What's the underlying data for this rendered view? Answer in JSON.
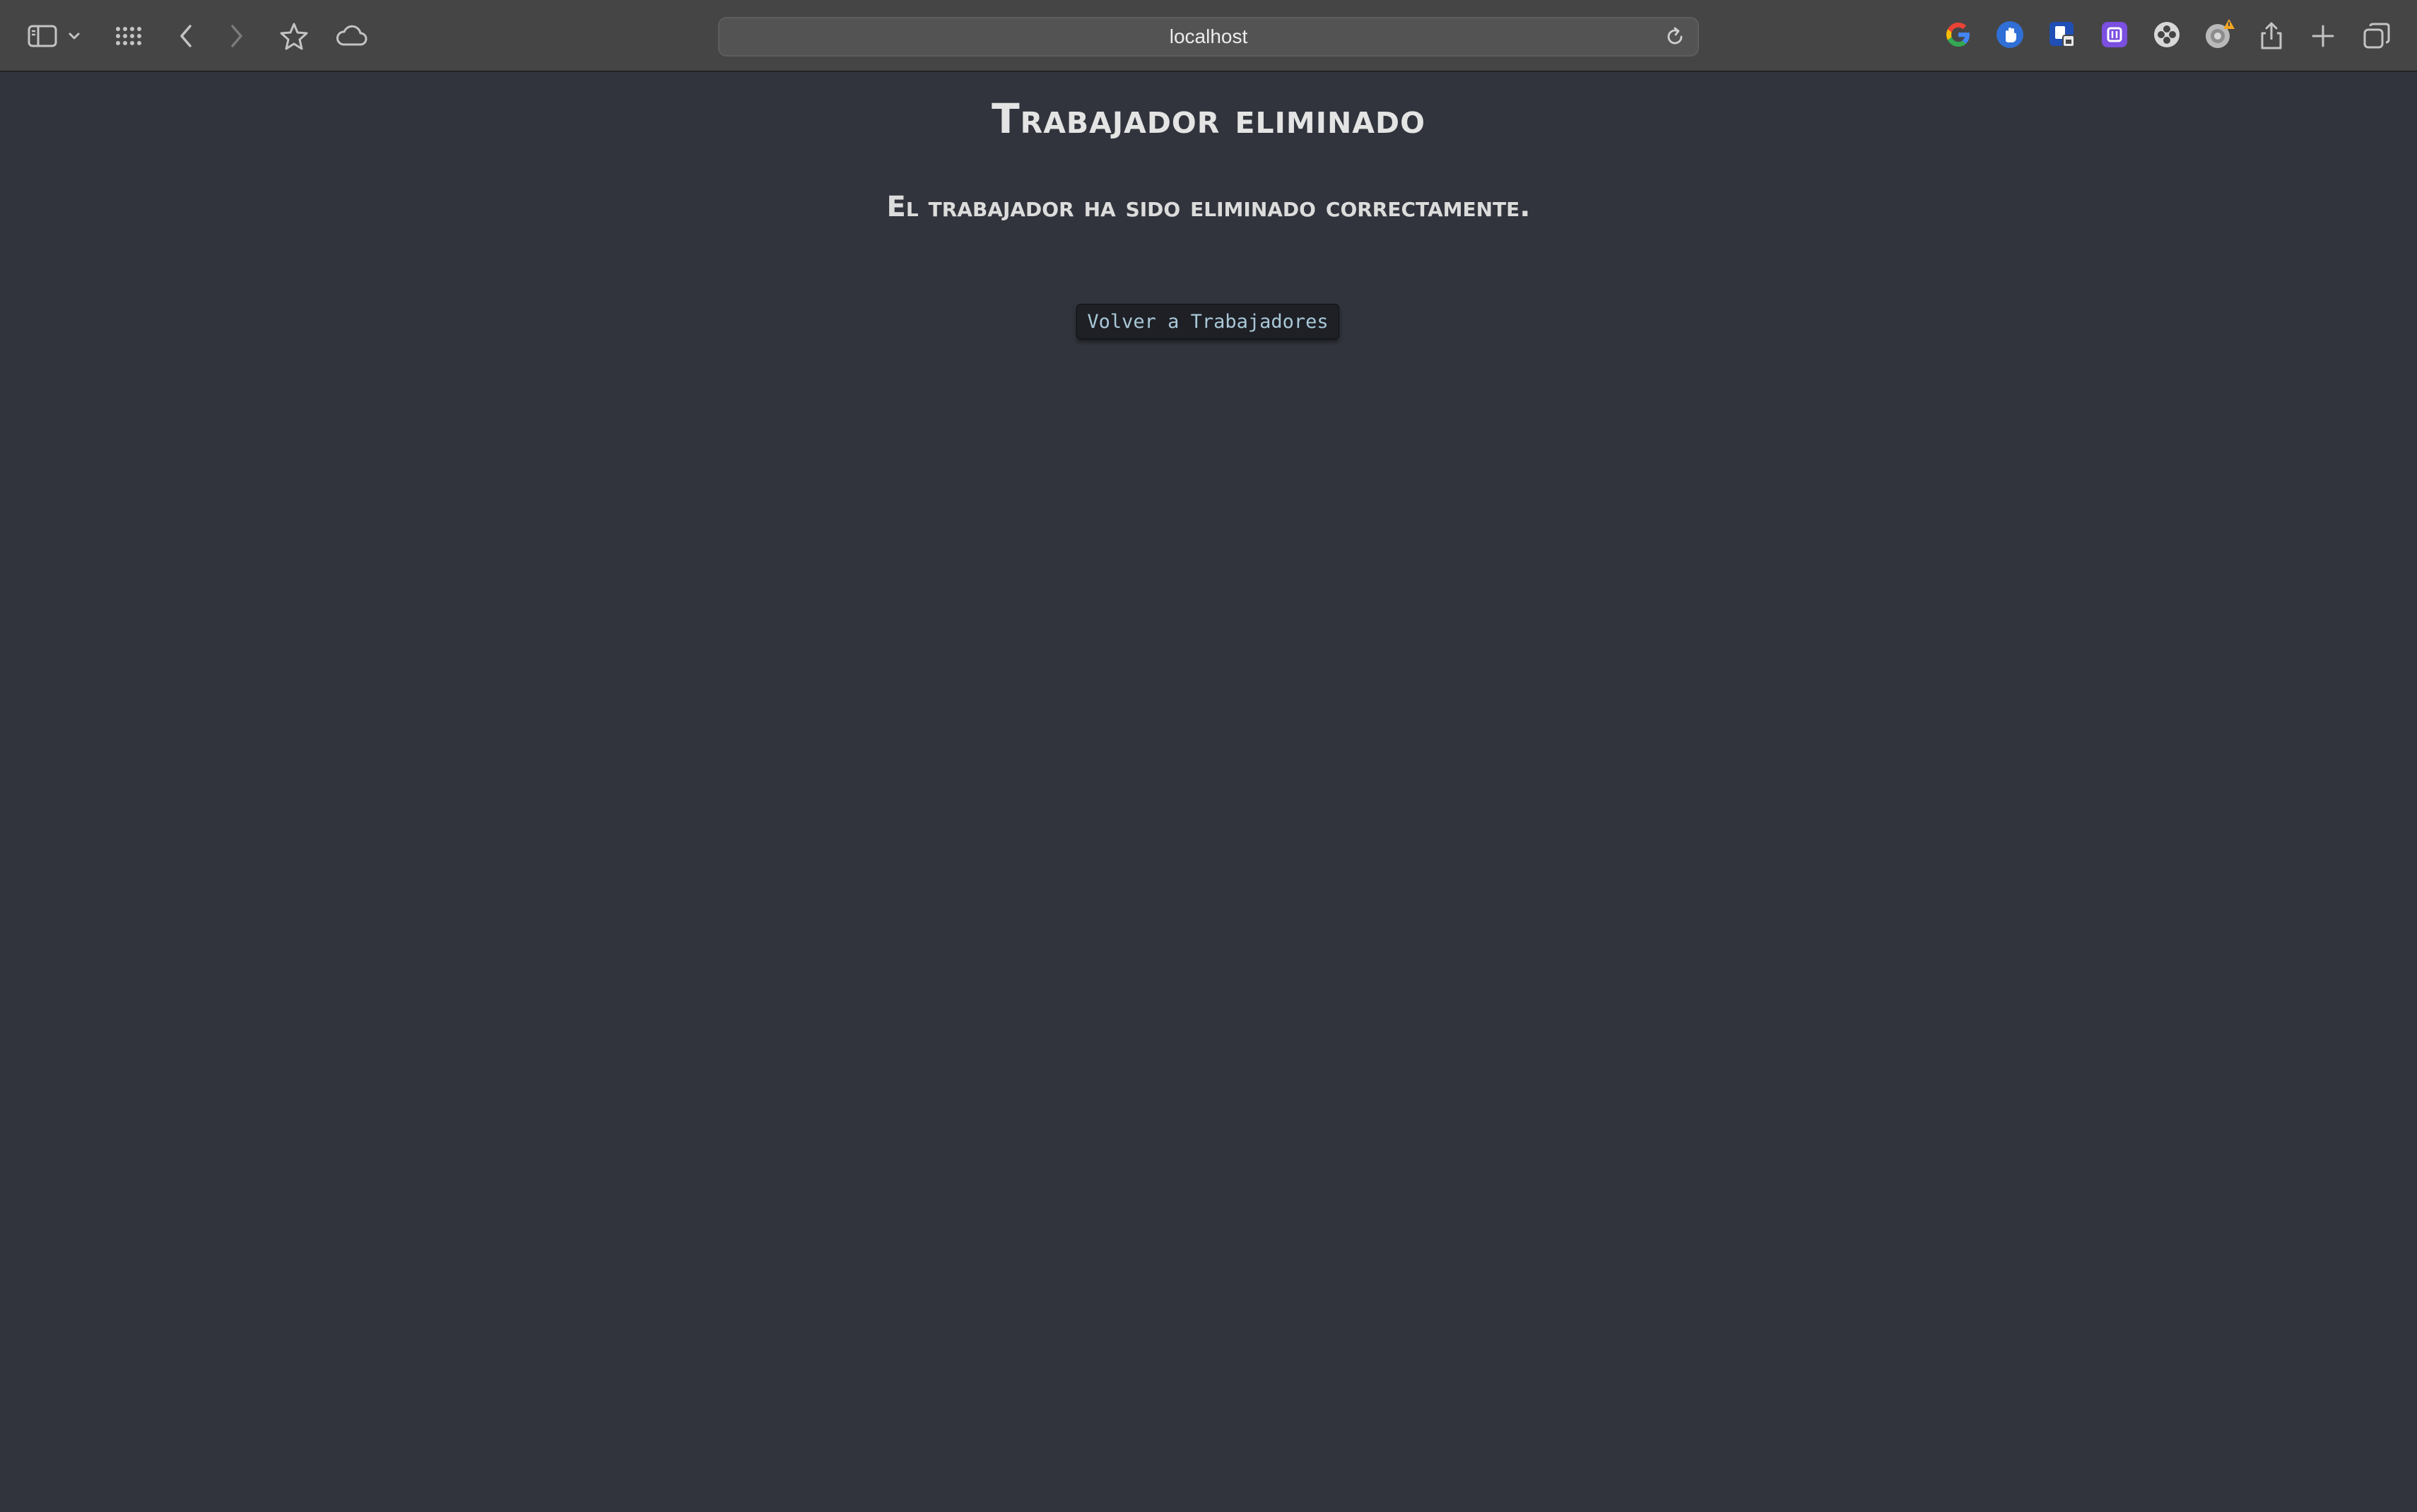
{
  "browser": {
    "address": "localhost",
    "toolbar_icons": [
      "sidebar-icon",
      "chevron-down-icon",
      "grid-icon",
      "back-icon",
      "forward-icon",
      "star-icon",
      "cloud-icon"
    ],
    "extensions": [
      "google-icon",
      "blue-hand-extension-icon",
      "shield-extension-icon",
      "purple-extension-icon",
      "puzzle-extension-icon",
      "gear-extension-icon"
    ],
    "right_icons": [
      "share-icon",
      "new-tab-icon",
      "tab-overview-icon"
    ],
    "colors": {
      "toolbar": "#454545",
      "page_background": "#31343c",
      "warning_badge": "#f5a623"
    }
  },
  "page": {
    "title": "Trabajador eliminado",
    "message": "El trabajador ha sido eliminado correctamente.",
    "back_button_label": "Volver a Trabajadores"
  }
}
